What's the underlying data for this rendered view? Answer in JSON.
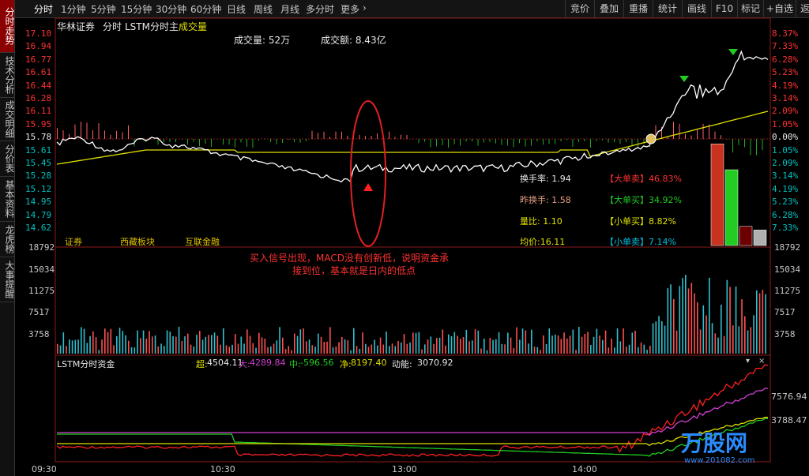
{
  "left_tabs": [
    {
      "label": "分时走势",
      "active": true
    },
    {
      "label": "技术分析",
      "active": false
    },
    {
      "label": "成交明细",
      "active": false
    },
    {
      "label": "分价表",
      "active": false
    },
    {
      "label": "基本资料",
      "active": false
    },
    {
      "label": "龙虎榜",
      "active": false
    },
    {
      "label": "大事提醒",
      "active": false
    }
  ],
  "toolbar": {
    "periods": [
      "分时",
      "1分钟",
      "5分钟",
      "15分钟",
      "30分钟",
      "60分钟",
      "日线",
      "周线",
      "月线",
      "多分时",
      "更多"
    ],
    "buttons": [
      "竞价",
      "叠加",
      "重播",
      "统计",
      "画线",
      "F10",
      "标记",
      "+自选",
      "返回"
    ]
  },
  "header": {
    "stock_name": "华林证券",
    "mode": "分时",
    "indicator": "LSTM分时主",
    "volume_label": "成交量",
    "volume_info": "成交量: 52万",
    "amount_info": "成交额: 8.43亿"
  },
  "price_axis_left": [
    "17.10",
    "16.94",
    "16.77",
    "16.61",
    "16.44",
    "16.28",
    "16.11",
    "15.95",
    "15.78",
    "15.61",
    "15.45",
    "15.28",
    "15.12",
    "14.95",
    "14.79",
    "14.62"
  ],
  "price_axis_right": [
    "8.37%",
    "7.33%",
    "6.28%",
    "5.23%",
    "4.19%",
    "3.14%",
    "2.09%",
    "1.05%",
    "0.00%",
    "1.05%",
    "2.09%",
    "3.14%",
    "4.19%",
    "5.23%",
    "6.28%",
    "7.33%"
  ],
  "sectors": [
    "证券",
    "西藏板块",
    "互联金融"
  ],
  "stats": {
    "turnover_label": "换手率: 1.94",
    "prev_turnover_label": "昨换手: 1.58",
    "volume_ratio_label": "量比: 1.10",
    "avg_price_label": "均价:16.11",
    "big_sell": "【大单卖】46.83%",
    "big_buy": "【大单买】34.92%",
    "small_buy": "【小单买】8.82%",
    "small_sell": "【小单卖】7.14%",
    "bar_values": [
      46.83,
      34.92,
      8.82,
      7.14
    ],
    "bar_colors": [
      "#c8321e",
      "#22cc22",
      "#6b0000",
      "#b0b0b0"
    ]
  },
  "annotation": {
    "line1": "买入信号出现，MACD没有创新低，说明资金承",
    "line2": "接到位，基本就是日内的低点"
  },
  "volume_axis": [
    "18792",
    "15034",
    "11275",
    "7517",
    "3758"
  ],
  "money_panel": {
    "title": "LSTM分时资金",
    "super_label": "超:",
    "super_value": "4504.11",
    "big_label": "大:",
    "big_value": "4289.84",
    "mid_label": "中:",
    "mid_value": "-596.56",
    "net_label": "净:",
    "net_value": "8197.40",
    "momentum_label": "动能:",
    "momentum_value": "3070.92",
    "axis": [
      "7576.94",
      "3788.47"
    ]
  },
  "time_axis": [
    "09:30",
    "10:30",
    "13:00",
    "14:00"
  ],
  "watermark": {
    "brand": "万股网",
    "url": "www.201082.com"
  },
  "colors": {
    "up": "#ff3232",
    "down": "#00c0c0",
    "price": "#ffffff",
    "avg": "#e0e000",
    "accent": "#ffd700"
  }
}
